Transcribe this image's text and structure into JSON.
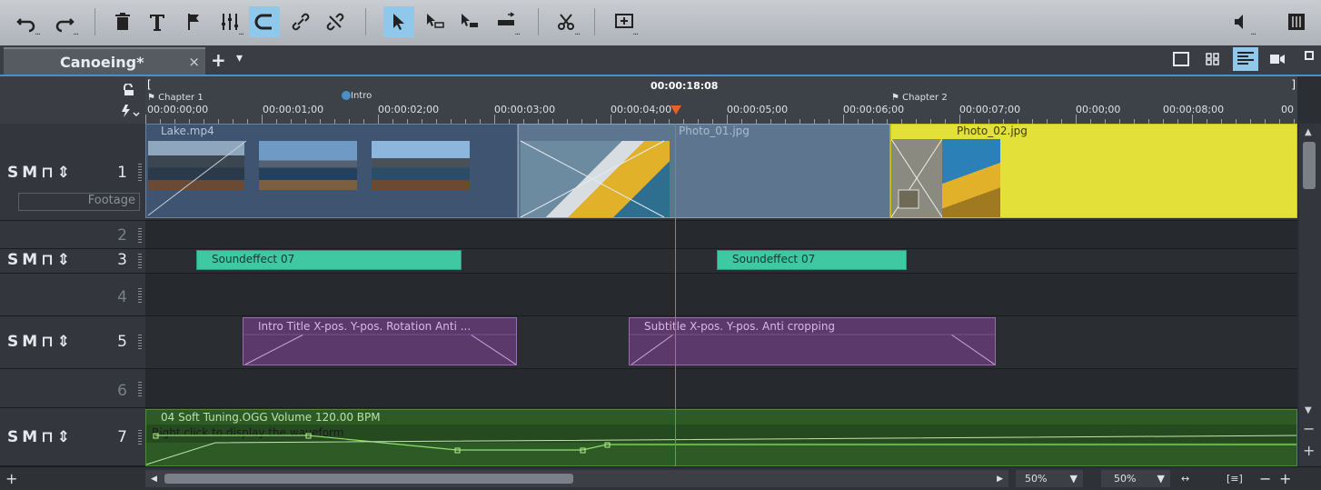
{
  "tab": {
    "name": "Canoeing*",
    "close": "×",
    "add": "+",
    "menu": "▾"
  },
  "ruler": {
    "position": "00:00:18:08",
    "markers": [
      {
        "label": "Chapter 1"
      },
      {
        "label": "Intro"
      },
      {
        "label": "Chapter 2"
      }
    ],
    "ticks": [
      "00:00:00;00",
      "00:00:01;00",
      "00:00:02;00",
      "00:00:03;00",
      "00:00:04;00",
      "00:00:05;00",
      "00:00:06;00",
      "00:00:07;00",
      "00:00;00",
      "00:00:08;00",
      "00"
    ]
  },
  "tracks": {
    "t1": {
      "num": "1",
      "s": "S",
      "m": "M",
      "footage_placeholder": "Footage"
    },
    "t2": {
      "num": "2"
    },
    "t3": {
      "num": "3",
      "s": "S",
      "m": "M"
    },
    "t4": {
      "num": "4"
    },
    "t5": {
      "num": "5",
      "s": "S",
      "m": "M"
    },
    "t6": {
      "num": "6"
    },
    "t7": {
      "num": "7",
      "s": "S",
      "m": "M"
    }
  },
  "clips": {
    "lake": "Lake.mp4",
    "photo1": "Photo_01.jpg",
    "photo2": "Photo_02.jpg",
    "sfx1": "Soundeffect 07",
    "sfx2": "Soundeffect 07",
    "title1": "Intro Title   X-pos.  Y-pos.  Rotation  Anti ...",
    "title2": "Subtitle   X-pos.  Y-pos.  Anti cropping",
    "audio": "04 Soft Tuning.OGG   Volume  120.00 BPM",
    "audio_hint": "Right click to display the waveform"
  },
  "bottom": {
    "zoom1": "50%",
    "zoom2": "50%",
    "plus": "+",
    "minus": "−"
  },
  "colors": {
    "accent": "#8fc8ea",
    "playhead": "#e8602c",
    "video": "#3e5470",
    "yellow": "#e3e03a",
    "sound": "#3fc9a3",
    "title": "#5b3a6b",
    "audio": "#2e5a26"
  }
}
